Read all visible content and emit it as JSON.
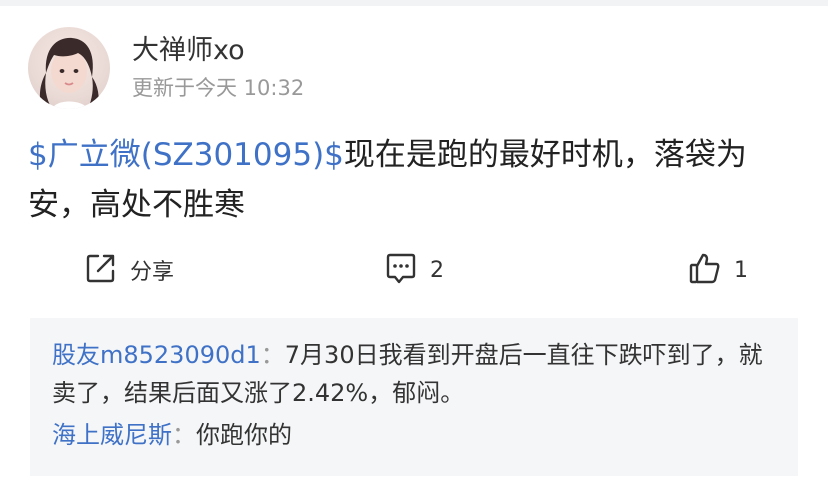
{
  "post": {
    "author": "大禅师xo",
    "timestamp": "更新于今天 10:32",
    "stock_link": "$广立微(SZ301095)$",
    "content_line1": "现在是跑的最好时机，落袋为",
    "content_line2": "安，高处不胜寒"
  },
  "actions": {
    "share_label": "分享",
    "share_icon": "share-icon",
    "comment_count": "2",
    "comment_icon": "comment-icon",
    "like_count": "1",
    "like_icon": "thumbs-up-icon"
  },
  "comments": [
    {
      "author": "股友m8523090d1",
      "separator": "：",
      "text": "7月30日我看到开盘后一直往下跌吓到了，就卖了，结果后面又涨了2.42%，郁闷。"
    },
    {
      "author": "海上威尼斯",
      "separator": "：",
      "text": "你跑你的"
    }
  ],
  "colors": {
    "link": "#3f72c7",
    "muted": "#999999",
    "comment_bg": "#f5f6f8"
  }
}
